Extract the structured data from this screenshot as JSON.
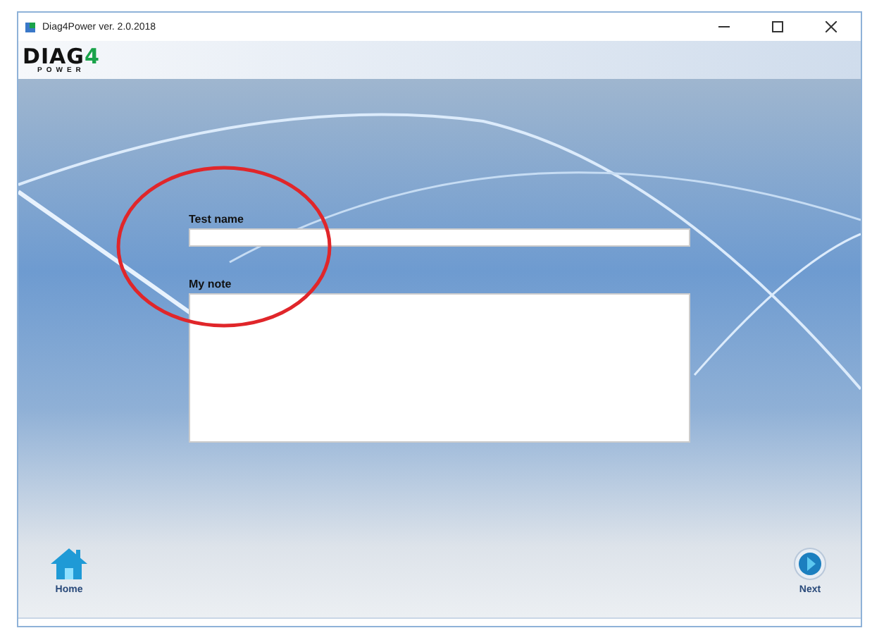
{
  "window": {
    "title": "Diag4Power ver. 2.0.2018"
  },
  "logo": {
    "word": "DIAG",
    "digit": "4",
    "tagline": "POWER"
  },
  "form": {
    "fields": [
      {
        "kind": "line",
        "label": "Test name"
      },
      {
        "kind": "area",
        "label": "My note"
      }
    ]
  },
  "nav": {
    "buttons": [
      {
        "kind": "home",
        "label": "Home"
      },
      {
        "kind": "next",
        "label": "Next"
      }
    ]
  }
}
